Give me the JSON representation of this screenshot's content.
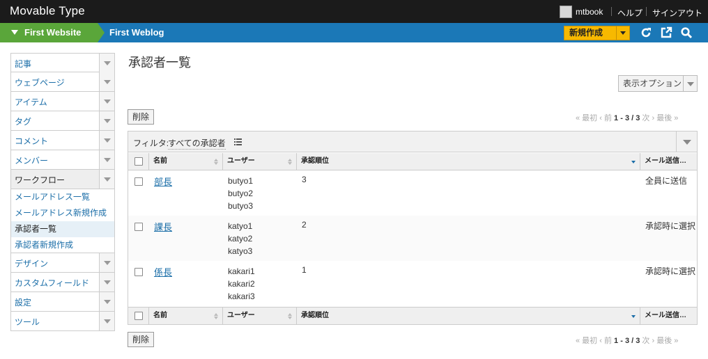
{
  "app": {
    "title": "Movable Type"
  },
  "topbar": {
    "user": "mtbook",
    "help": "ヘルプ",
    "signout": "サインアウト"
  },
  "nav": {
    "website": "First Website",
    "blog": "First Weblog",
    "new_button": "新規作成"
  },
  "sidebar": {
    "items": [
      {
        "label": "記事"
      },
      {
        "label": "ウェブページ"
      },
      {
        "label": "アイテム"
      },
      {
        "label": "タグ"
      },
      {
        "label": "コメント"
      },
      {
        "label": "メンバー"
      },
      {
        "label": "ワークフロー"
      }
    ],
    "workflow_sub": [
      {
        "label": "メールアドレス一覧"
      },
      {
        "label": "メールアドレス新規作成"
      },
      {
        "label": "承認者一覧"
      },
      {
        "label": "承認者新規作成"
      }
    ],
    "items_after": [
      {
        "label": "デザイン"
      },
      {
        "label": "カスタムフィールド"
      },
      {
        "label": "設定"
      },
      {
        "label": "ツール"
      }
    ]
  },
  "main": {
    "title": "承認者一覧",
    "display_options": "表示オプション",
    "delete_label": "削除",
    "pager": {
      "first": "« 最初",
      "prev": "‹ 前",
      "range": "1 - 3 / 3",
      "next": "次 ›",
      "last": "最後 »"
    },
    "filter": {
      "label": "フィルタ:",
      "value": "すべての承認者"
    },
    "columns": {
      "name": "名前",
      "user": "ユーザー",
      "order": "承認順位",
      "mail": "メール送信…"
    },
    "rows": [
      {
        "name": "部長",
        "users": [
          "butyo1",
          "butyo2",
          "butyo3"
        ],
        "order": "3",
        "mail": "全員に送信"
      },
      {
        "name": "課長",
        "users": [
          "katyo1",
          "katyo2",
          "katyo3"
        ],
        "order": "2",
        "mail": "承認時に選択"
      },
      {
        "name": "係長",
        "users": [
          "kakari1",
          "kakari2",
          "kakari3"
        ],
        "order": "1",
        "mail": "承認時に選択"
      }
    ]
  }
}
